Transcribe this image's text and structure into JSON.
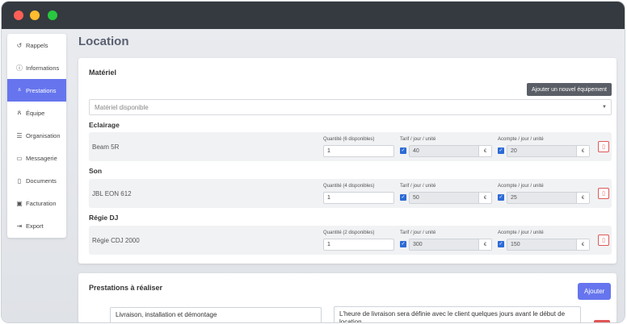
{
  "page_title": "Location",
  "sidebar": {
    "items": [
      {
        "label": "Rappels",
        "icon": "↺"
      },
      {
        "label": "Informations",
        "icon": "ⓘ"
      },
      {
        "label": "Prestations",
        "icon": "ᐞ"
      },
      {
        "label": "Équipe",
        "icon": "ጸ"
      },
      {
        "label": "Organisation",
        "icon": "☰"
      },
      {
        "label": "Messagerie",
        "icon": "▭"
      },
      {
        "label": "Documents",
        "icon": "▯"
      },
      {
        "label": "Facturation",
        "icon": "▣"
      },
      {
        "label": "Export",
        "icon": "⇥"
      }
    ],
    "active_index": 2
  },
  "materiel": {
    "title": "Matériel",
    "add_button": "Ajouter un nouvel équipement",
    "select_placeholder": "Matériel disponible",
    "categories": [
      {
        "title": "Eclairage",
        "item": {
          "name": "Beam 5R",
          "qty_label": "Quantité (6 disponibles)",
          "qty": "1",
          "tarif_label": "Tarif / jour / unité",
          "tarif": "40",
          "acompte_label": "Acompte / jour / unité",
          "acompte": "20",
          "currency": "€"
        }
      },
      {
        "title": "Son",
        "item": {
          "name": "JBL EON 612",
          "qty_label": "Quantité (4 disponibles)",
          "qty": "1",
          "tarif_label": "Tarif / jour / unité",
          "tarif": "50",
          "acompte_label": "Acompte / jour / unité",
          "acompte": "25",
          "currency": "€"
        }
      },
      {
        "title": "Régie DJ",
        "item": {
          "name": "Régie CDJ 2000",
          "qty_label": "Quantité (2 disponibles)",
          "qty": "1",
          "tarif_label": "Tarif / jour / unité",
          "tarif": "300",
          "acompte_label": "Acompte / jour / unité",
          "acompte": "150",
          "currency": "€"
        }
      }
    ]
  },
  "prestations": {
    "title": "Prestations à réaliser",
    "add_button": "Ajouter",
    "task": "Livraison, installation et démontage",
    "note": "L'heure de livraison sera définie avec le client quelques jours avant le début de location."
  }
}
